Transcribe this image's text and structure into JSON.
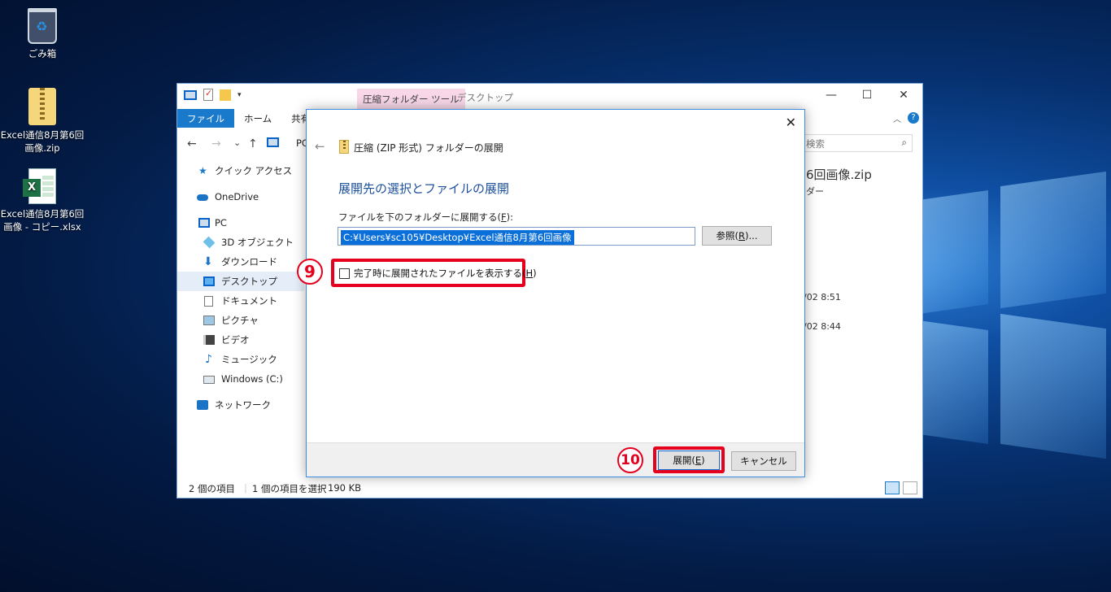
{
  "desktop": {
    "icons": [
      {
        "label": "ごみ箱"
      },
      {
        "label": "Excel通信8月第6回画像.zip"
      },
      {
        "label": "Excel通信8月第6回画像 - コピー.xlsx",
        "badge": "X"
      }
    ]
  },
  "explorer": {
    "context_tab": "圧縮フォルダー ツール",
    "title": "デスクトップ",
    "window_controls": {
      "minimize": "—",
      "maximize": "☐",
      "close": "✕"
    },
    "ribbon_tabs": [
      "ファイル",
      "ホーム",
      "共有"
    ],
    "help": "?",
    "chevron": "︿",
    "nav": {
      "back": "←",
      "forward": "→",
      "recent": "⌄",
      "up": "↑"
    },
    "address": "PC",
    "search_placeholder": "検索",
    "nav_pane": [
      {
        "label": "クイック アクセス"
      },
      {
        "label": "OneDrive"
      },
      {
        "label": "PC"
      },
      {
        "label": "3D オブジェクト"
      },
      {
        "label": "ダウンロード"
      },
      {
        "label": "デスクトップ"
      },
      {
        "label": "ドキュメント"
      },
      {
        "label": "ピクチャ"
      },
      {
        "label": "ビデオ"
      },
      {
        "label": "ミュージック"
      },
      {
        "label": "Windows (C:)"
      },
      {
        "label": "ネットワーク"
      }
    ],
    "details": {
      "name_fragment": "6回画像.zip",
      "type_fragment": "ダー",
      "date1": "/02 8:51",
      "date2": "/02 8:44"
    },
    "status": {
      "items": "2 個の項目",
      "selected": "1 個の項目を選択",
      "size": "190 KB"
    }
  },
  "dialog": {
    "close": "✕",
    "back": "←",
    "title": "圧縮 (ZIP 形式) フォルダーの展開",
    "heading": "展開先の選択とファイルの展開",
    "dest_label": "ファイルを下のフォルダーに展開する(",
    "dest_label_key": "F",
    "dest_label_end": "):",
    "dest_path": "C:¥Users¥sc105¥Desktop¥Excel通信8月第6回画像",
    "browse_label": "参照(",
    "browse_key": "R",
    "browse_end": ")...",
    "show_files_label": "完了時に展開されたファイルを表示する(",
    "show_files_key": "H",
    "show_files_end": ")",
    "show_files_checked": false,
    "extract_label": "展開(",
    "extract_key": "E",
    "extract_end": ")",
    "cancel_label": "キャンセル"
  },
  "annotations": {
    "step9": "9",
    "step10": "10",
    "color": "#e5001e"
  }
}
